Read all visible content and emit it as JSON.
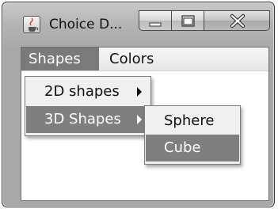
{
  "window": {
    "title": "Choice D...",
    "app_icon": "java-cup-icon",
    "controls": [
      "minimize-icon",
      "maximize-icon",
      "close-icon"
    ]
  },
  "menubar": {
    "items": [
      {
        "label": "Shapes",
        "active": true
      },
      {
        "label": "Colors",
        "active": false
      }
    ]
  },
  "shapes_menu": {
    "items": [
      {
        "label": "2D shapes",
        "submenu": true,
        "selected": false
      },
      {
        "label": "3D Shapes",
        "submenu": true,
        "selected": true
      }
    ]
  },
  "submenu_3d": {
    "items": [
      {
        "label": "Sphere",
        "selected": false
      },
      {
        "label": "Cube",
        "selected": true
      }
    ]
  },
  "colors": {
    "selection": "#7f7f7f",
    "menubar": "#eeeeee",
    "popup": "#f0f0f0"
  }
}
